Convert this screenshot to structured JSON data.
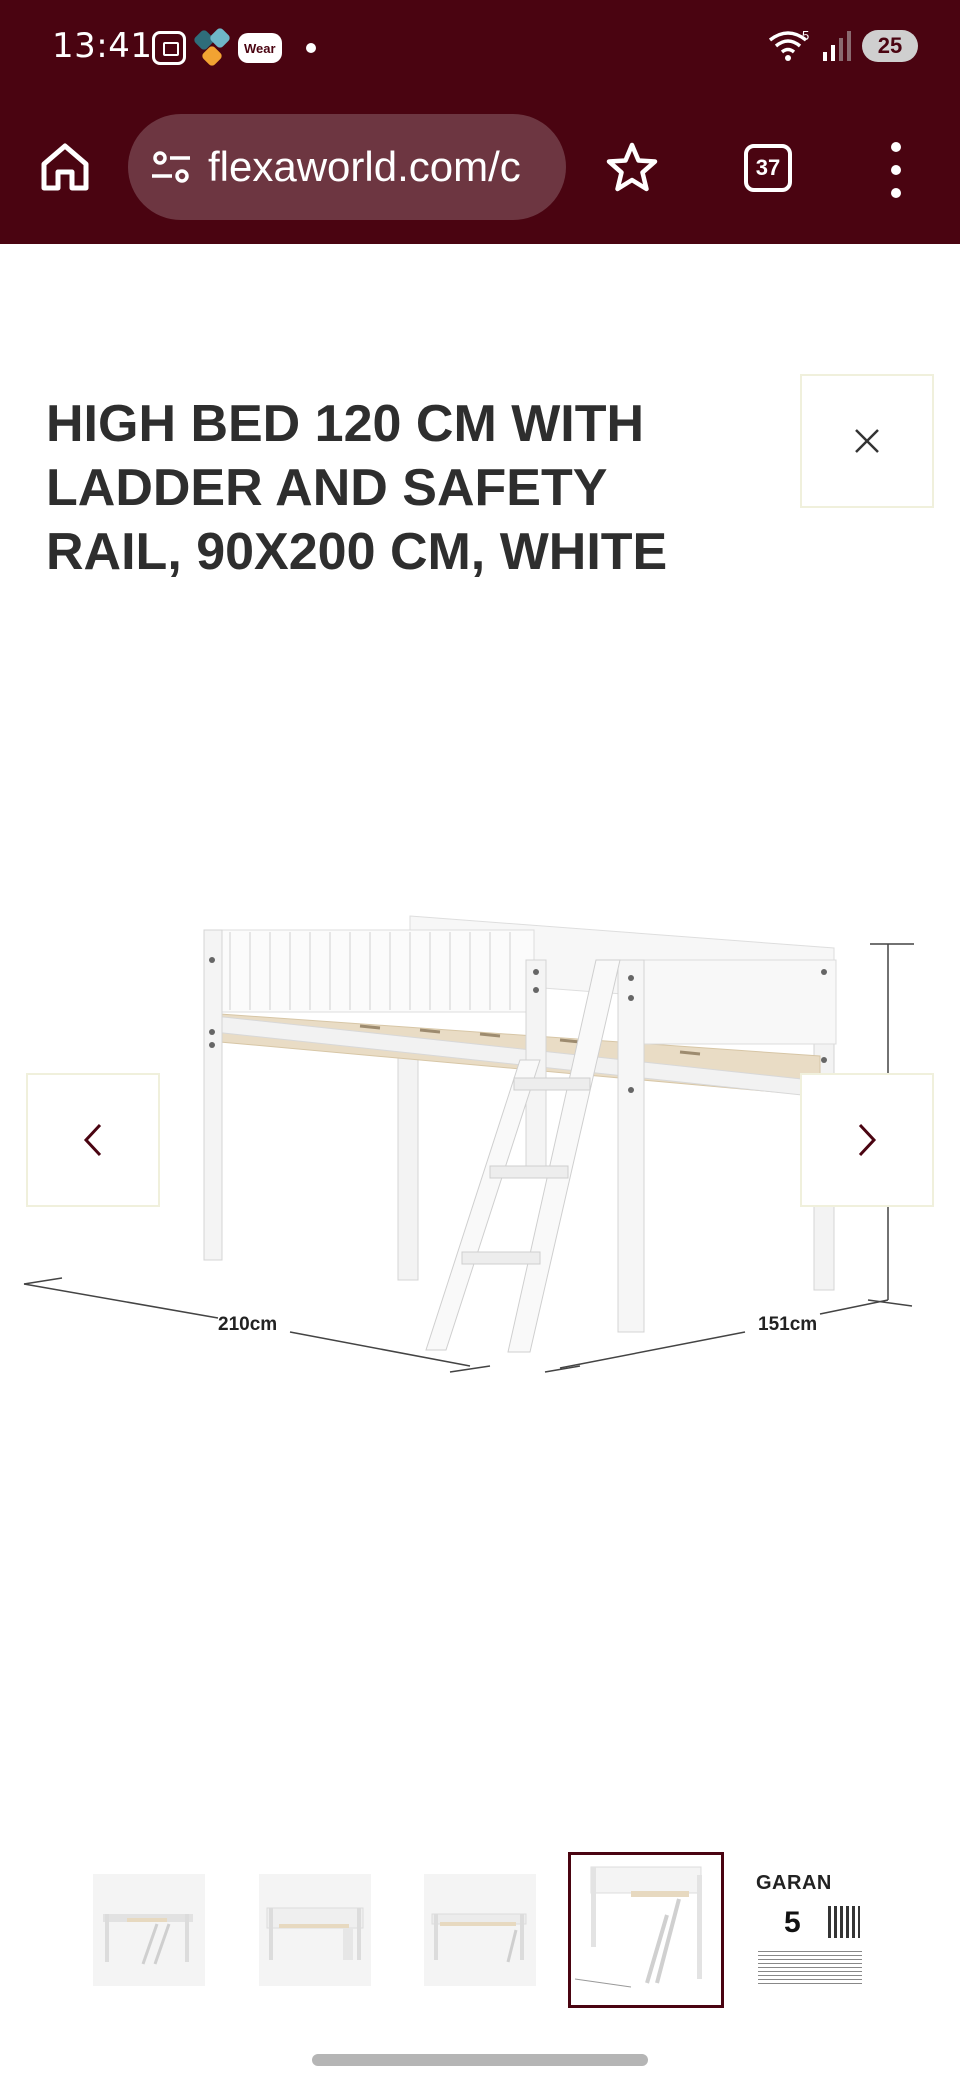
{
  "status_bar": {
    "time": "13:41",
    "wear_label": "Wear",
    "network_sup": "5",
    "battery": "25"
  },
  "browser": {
    "url": "flexaworld.com/c",
    "tab_count": "37"
  },
  "product": {
    "title": "HIGH BED 120 CM WITH LADDER AND SAFETY RAIL, 90X200 CM, WHITE",
    "dimensions": {
      "length": "210cm",
      "depth": "151cm"
    }
  },
  "gallery": {
    "active_index": 4,
    "thumbnails_count": 5,
    "guarantee_thumb": {
      "title": "GARAN",
      "years": "5"
    }
  },
  "colors": {
    "brand": "#4a0411",
    "urlbar": "#6d3641",
    "title_text": "#2e2e2e",
    "active_thumb_border": "#4a0411"
  },
  "icons": [
    "home-icon",
    "tune-icon",
    "star-icon",
    "tabs-icon",
    "more-vert-icon",
    "close-icon",
    "chevron-left-icon",
    "chevron-right-icon"
  ]
}
